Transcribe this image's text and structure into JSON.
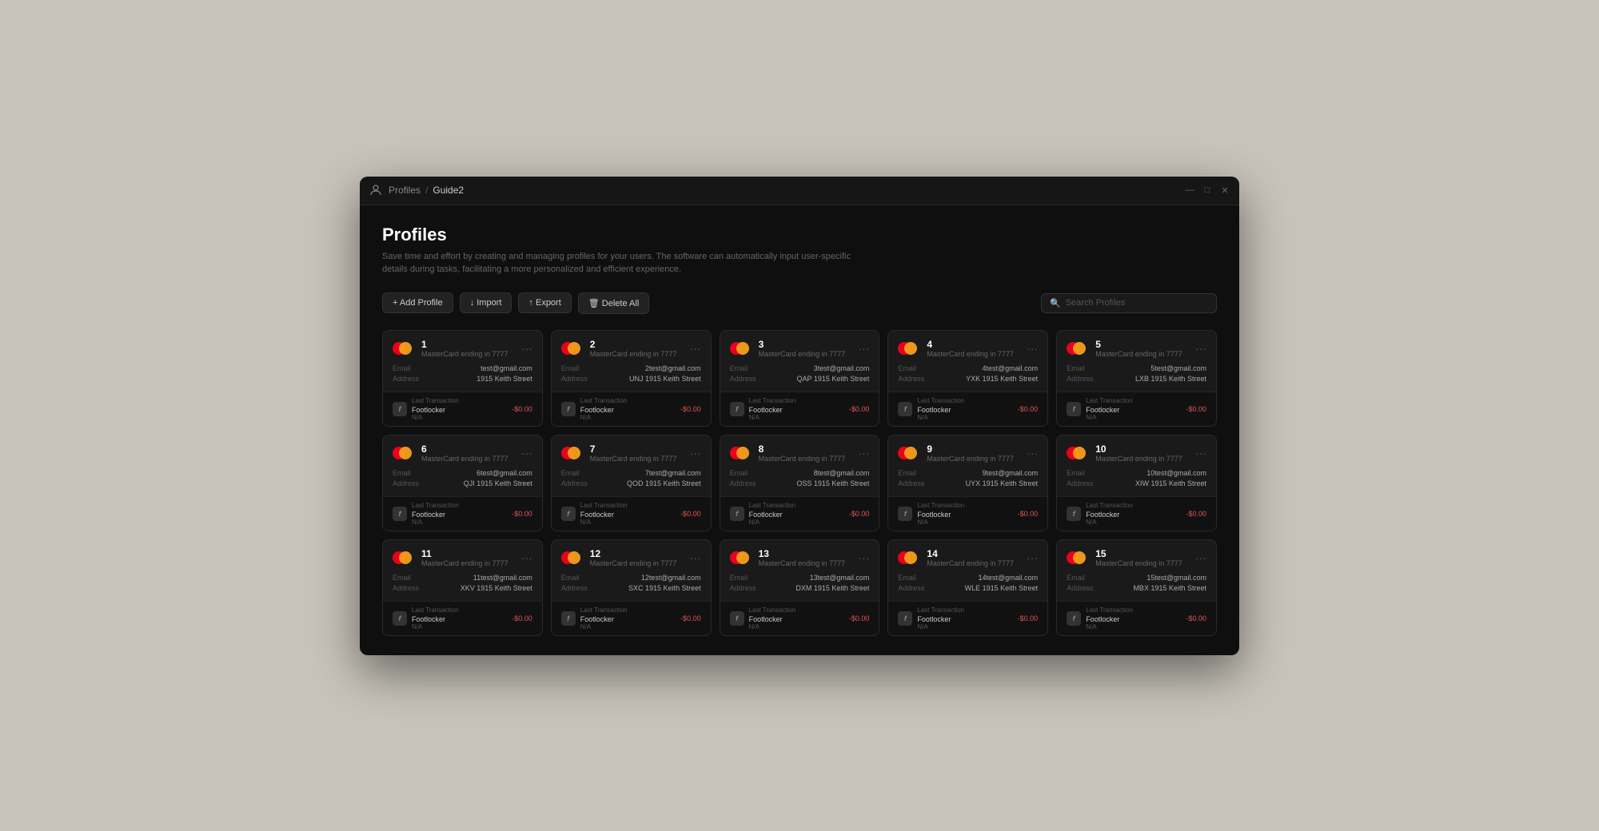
{
  "window": {
    "title": "Profiles",
    "breadcrumb_root": "Profiles",
    "breadcrumb_sep": "/",
    "breadcrumb_current": "Guide2",
    "controls": [
      "—",
      "□",
      "✕"
    ]
  },
  "page": {
    "title": "Profiles",
    "description": "Save time and effort by creating and managing profiles for your users. The software can automatically input user-specific details during tasks, facilitating a more personalized and efficient experience."
  },
  "toolbar": {
    "add_label": "+ Add Profile",
    "import_label": "↓ Import",
    "export_label": "↑ Export",
    "delete_label": "🗑 Delete All"
  },
  "search": {
    "placeholder": "Search Profiles"
  },
  "profiles": [
    {
      "num": "1",
      "card_type": "MasterCard ending in 7777",
      "email": "test@gmail.com",
      "address": "1915 Keith Street",
      "trans_store": "Footlocker",
      "trans_sub": "N/A",
      "trans_amount": "-$0.00"
    },
    {
      "num": "2",
      "card_type": "MasterCard ending in 7777",
      "email": "2test@gmail.com",
      "address": "UNJ 1915 Keith Street",
      "trans_store": "Footlocker",
      "trans_sub": "N/A",
      "trans_amount": "-$0.00"
    },
    {
      "num": "3",
      "card_type": "MasterCard ending in 7777",
      "email": "3test@gmail.com",
      "address": "QAP 1915 Keith Street",
      "trans_store": "Footlocker",
      "trans_sub": "N/A",
      "trans_amount": "-$0.00"
    },
    {
      "num": "4",
      "card_type": "MasterCard ending in 7777",
      "email": "4test@gmail.com",
      "address": "YXK 1915 Keith Street",
      "trans_store": "Footlocker",
      "trans_sub": "N/A",
      "trans_amount": "-$0.00"
    },
    {
      "num": "5",
      "card_type": "MasterCard ending in 7777",
      "email": "5test@gmail.com",
      "address": "LXB 1915 Keith Street",
      "trans_store": "Footlocker",
      "trans_sub": "N/A",
      "trans_amount": "-$0.00"
    },
    {
      "num": "6",
      "card_type": "MasterCard ending in 7777",
      "email": "6test@gmail.com",
      "address": "QJI 1915 Keith Street",
      "trans_store": "Footlocker",
      "trans_sub": "N/A",
      "trans_amount": "-$0.00"
    },
    {
      "num": "7",
      "card_type": "MasterCard ending in 7777",
      "email": "7test@gmail.com",
      "address": "QOD 1915 Keith Street",
      "trans_store": "Footlocker",
      "trans_sub": "N/A",
      "trans_amount": "-$0.00"
    },
    {
      "num": "8",
      "card_type": "MasterCard ending in 7777",
      "email": "8test@gmail.com",
      "address": "OSS 1915 Keith Street",
      "trans_store": "Footlocker",
      "trans_sub": "N/A",
      "trans_amount": "-$0.00"
    },
    {
      "num": "9",
      "card_type": "MasterCard ending in 7777",
      "email": "9test@gmail.com",
      "address": "UYX 1915 Keith Street",
      "trans_store": "Footlocker",
      "trans_sub": "N/A",
      "trans_amount": "-$0.00"
    },
    {
      "num": "10",
      "card_type": "MasterCard ending in 7777",
      "email": "10test@gmail.com",
      "address": "XIW 1915 Keith Street",
      "trans_store": "Footlocker",
      "trans_sub": "N/A",
      "trans_amount": "-$0.00"
    },
    {
      "num": "11",
      "card_type": "MasterCard ending in 7777",
      "email": "11test@gmail.com",
      "address": "XKV 1915 Keith Street",
      "trans_store": "Footlocker",
      "trans_sub": "N/A",
      "trans_amount": "-$0.00"
    },
    {
      "num": "12",
      "card_type": "MasterCard ending in 7777",
      "email": "12test@gmail.com",
      "address": "SXC 1915 Keith Street",
      "trans_store": "Footlocker",
      "trans_sub": "N/A",
      "trans_amount": "-$0.00"
    },
    {
      "num": "13",
      "card_type": "MasterCard ending in 7777",
      "email": "13test@gmail.com",
      "address": "DXM 1915 Keith Street",
      "trans_store": "Footlocker",
      "trans_sub": "N/A",
      "trans_amount": "-$0.00"
    },
    {
      "num": "14",
      "card_type": "MasterCard ending in 7777",
      "email": "14test@gmail.com",
      "address": "WLE 1915 Keith Street",
      "trans_store": "Footlocker",
      "trans_sub": "N/A",
      "trans_amount": "-$0.00"
    },
    {
      "num": "15",
      "card_type": "MasterCard ending in 7777",
      "email": "15test@gmail.com",
      "address": "MBX 1915 Keith Street",
      "trans_store": "Footlocker",
      "trans_sub": "N/A",
      "trans_amount": "-$0.00"
    }
  ],
  "labels": {
    "email": "Email",
    "address": "Address",
    "last_transaction": "Last Transaction"
  }
}
